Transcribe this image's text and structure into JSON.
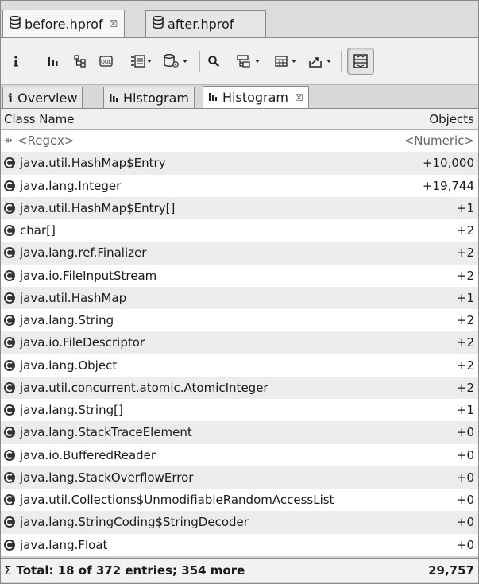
{
  "editor_tabs": [
    {
      "label": "before.hprof",
      "active": true
    },
    {
      "label": "after.hprof",
      "active": false
    }
  ],
  "view_tabs": [
    {
      "icon": "i",
      "label": "Overview"
    },
    {
      "icon": "histogram",
      "label": "Histogram"
    },
    {
      "icon": "histogram",
      "label": "Histogram",
      "active": true
    }
  ],
  "table": {
    "columns": [
      "Class Name",
      "Objects"
    ],
    "filter_row": {
      "name": "<Regex>",
      "value": "<Numeric>"
    },
    "rows": [
      {
        "name": "java.util.HashMap$Entry",
        "value": "+10,000"
      },
      {
        "name": "java.lang.Integer",
        "value": "+19,744"
      },
      {
        "name": "java.util.HashMap$Entry[]",
        "value": "+1"
      },
      {
        "name": "char[]",
        "value": "+2"
      },
      {
        "name": "java.lang.ref.Finalizer",
        "value": "+2"
      },
      {
        "name": "java.io.FileInputStream",
        "value": "+2"
      },
      {
        "name": "java.util.HashMap",
        "value": "+1"
      },
      {
        "name": "java.lang.String",
        "value": "+2"
      },
      {
        "name": "java.io.FileDescriptor",
        "value": "+2"
      },
      {
        "name": "java.lang.Object",
        "value": "+2"
      },
      {
        "name": "java.util.concurrent.atomic.AtomicInteger",
        "value": "+2"
      },
      {
        "name": "java.lang.String[]",
        "value": "+1"
      },
      {
        "name": "java.lang.StackTraceElement",
        "value": "+0"
      },
      {
        "name": "java.io.BufferedReader",
        "value": "+0"
      },
      {
        "name": "java.lang.StackOverflowError",
        "value": "+0"
      },
      {
        "name": "java.util.Collections$UnmodifiableRandomAccessList",
        "value": "+0"
      },
      {
        "name": "java.lang.StringCoding$StringDecoder",
        "value": "+0"
      },
      {
        "name": "java.lang.Float",
        "value": "+0"
      }
    ],
    "total": {
      "label": "Total: 18 of 372 entries; 354 more",
      "value": "29,757"
    }
  }
}
